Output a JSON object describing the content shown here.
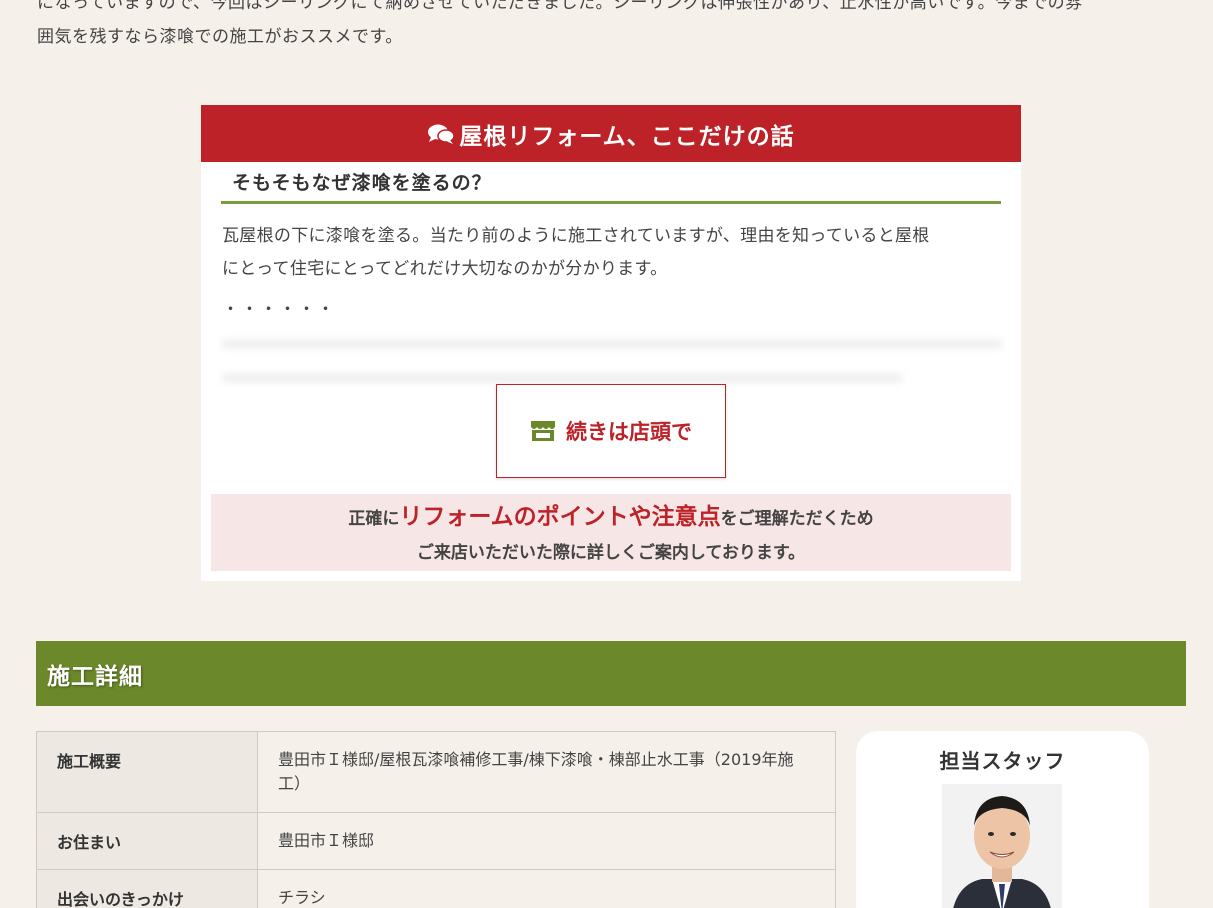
{
  "intro": {
    "line1": "になっていますので、今回はシーリングにて納めさせていただきました。シーリングは伸張性があり、止水性が高いです。今までの雰",
    "line2": "囲気を残すなら漆喰での施工がおススメです。"
  },
  "column": {
    "header": "屋根リフォーム、ここだけの話",
    "subtitle": "そもそもなぜ漆喰を塗るの？",
    "body_line1": "瓦屋根の下に漆喰を塗る。当たり前のように施工されていますが、理由を知っていると屋根",
    "body_line2": "にとって住宅にとってどれだけ大切なのかが分かります。",
    "dots": "・・・・・・",
    "continue_label": "続きは店頭で",
    "note_prefix": "正確に",
    "note_highlight": "リフォームのポイントや注意点",
    "note_suffix": "をご理解ただくため",
    "note_line2": "ご来店いただいた際に詳しくご案内しております。"
  },
  "colors": {
    "accent_red": "#bc2228",
    "accent_green": "#6b882a",
    "background": "#f5f0ea"
  },
  "details": {
    "section_title": "施工詳細",
    "rows": [
      {
        "label": "施工概要",
        "value": "豊田市Ｉ様邸/屋根瓦漆喰補修工事/棟下漆喰・棟部止水工事（2019年施工）"
      },
      {
        "label": "お住まい",
        "value": "豊田市Ｉ様邸"
      },
      {
        "label": "出会いのきっかけ",
        "value": "チラシ"
      }
    ]
  },
  "staff": {
    "title": "担当スタッフ"
  }
}
